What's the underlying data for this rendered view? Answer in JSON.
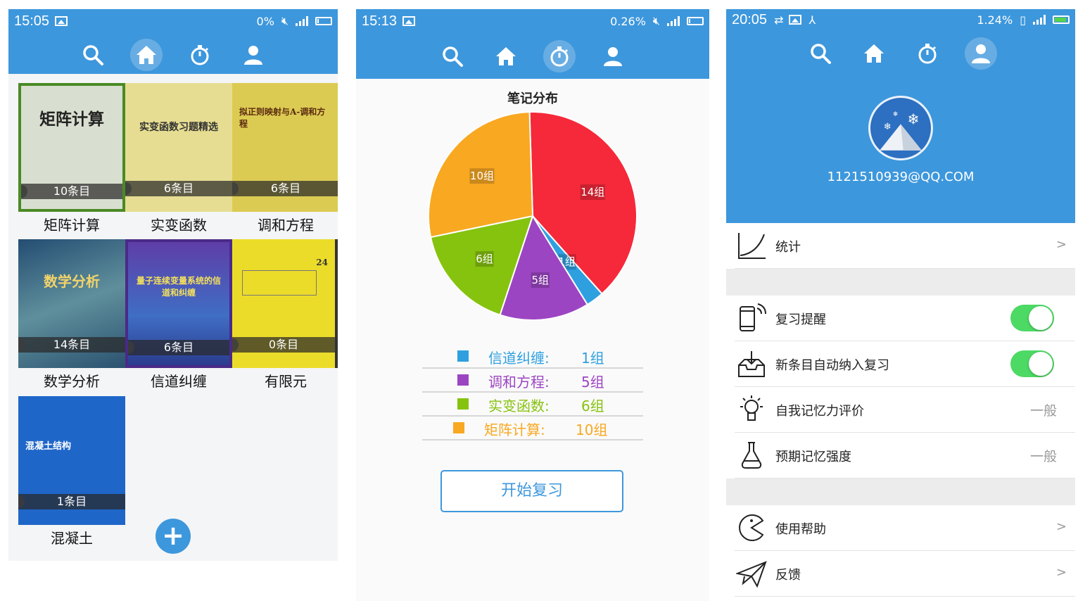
{
  "screen1": {
    "status": {
      "time": "15:05",
      "speed": "0%"
    },
    "nav": [
      "search-icon",
      "home-icon",
      "timer-icon",
      "user-icon"
    ],
    "books": [
      {
        "cover_title": "矩阵计算",
        "count": "10条目",
        "name": "矩阵计算",
        "color": "#d9dfd0"
      },
      {
        "cover_title": "实变函数习题精选",
        "count": "6条目",
        "name": "实变函数",
        "color": "#e6dd92"
      },
      {
        "cover_title": "拟正则映射与A-调和方程",
        "count": "6条目",
        "name": "调和方程",
        "color": "#dccb52"
      },
      {
        "cover_title": "数学分析",
        "count": "14条目",
        "name": "数学分析",
        "color": "#3e6c8a"
      },
      {
        "cover_title": "量子连续变量系统的信道和纠缠",
        "count": "6条目",
        "name": "信道纠缠",
        "color": "#6a5ab8"
      },
      {
        "cover_title": "24",
        "count": "0条目",
        "name": "有限元",
        "color": "#ecdc2a"
      },
      {
        "cover_title": "混凝土结构",
        "count": "1条目",
        "name": "混凝土",
        "color": "#1f66c9"
      }
    ],
    "add_label": "+"
  },
  "screen2": {
    "status": {
      "time": "15:13",
      "speed": "0.26%"
    },
    "nav": [
      "search-icon",
      "home-icon",
      "timer-icon",
      "user-icon"
    ],
    "start_button": "开始复习",
    "chart_data": {
      "type": "pie",
      "title": "笔记分布",
      "slices": [
        {
          "label": "调和方程",
          "value": 14,
          "data_label": "14组",
          "color": "#f5293a"
        },
        {
          "label": "信道纠缠",
          "value": 1,
          "data_label": "1组",
          "color": "#2ea0e0"
        },
        {
          "label": "调和方程",
          "value": 5,
          "data_label": "5组",
          "color": "#9c45c2"
        },
        {
          "label": "实变函数",
          "value": 6,
          "data_label": "6组",
          "color": "#86c30f"
        },
        {
          "label": "矩阵计算",
          "value": 10,
          "data_label": "10组",
          "color": "#f8a821"
        }
      ],
      "legend": [
        {
          "name": "信道纠缠:",
          "value": "1组",
          "color": "#2ea0e0"
        },
        {
          "name": "调和方程:",
          "value": "5组",
          "color": "#9c45c2"
        },
        {
          "name": "实变函数:",
          "value": "6组",
          "color": "#86c30f"
        },
        {
          "name": "矩阵计算:",
          "value": "10组",
          "color": "#f8a821"
        }
      ]
    }
  },
  "screen3": {
    "status": {
      "time": "20:05",
      "speed": "1.24%"
    },
    "nav": [
      "search-icon",
      "home-icon",
      "timer-icon",
      "user-icon"
    ],
    "email": "1121510939@QQ.COM",
    "menu": {
      "stats": {
        "label": "统计",
        "arrow": ">"
      },
      "reminder": {
        "label": "复习提醒",
        "on": true
      },
      "auto_add": {
        "label": "新条目自动纳入复习",
        "on": true
      },
      "self_eval": {
        "label": "自我记忆力评价",
        "value": "一般"
      },
      "expected": {
        "label": "预期记忆强度",
        "value": "一般"
      },
      "help": {
        "label": "使用帮助",
        "arrow": ">"
      },
      "feedback": {
        "label": "反馈",
        "arrow": ">"
      }
    }
  }
}
